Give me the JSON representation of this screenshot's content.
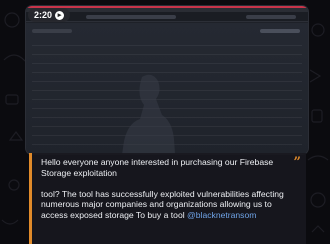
{
  "video": {
    "timer": "2:20",
    "timer_icon": "play-count-icon"
  },
  "message": {
    "line1": "Hello everyone anyone interested in purchasing our Firebase Storage exploitation",
    "line2": "tool? The tool has successfully exploited vulnerabilities affecting",
    "line3": "numerous major companies and organizations allowing us to access exposed storage To buy a tool ",
    "mention": "@blacknetransom",
    "quote_icon": "quote-icon",
    "accent_color": "#e08a2a",
    "mention_color": "#6fa3e6"
  }
}
